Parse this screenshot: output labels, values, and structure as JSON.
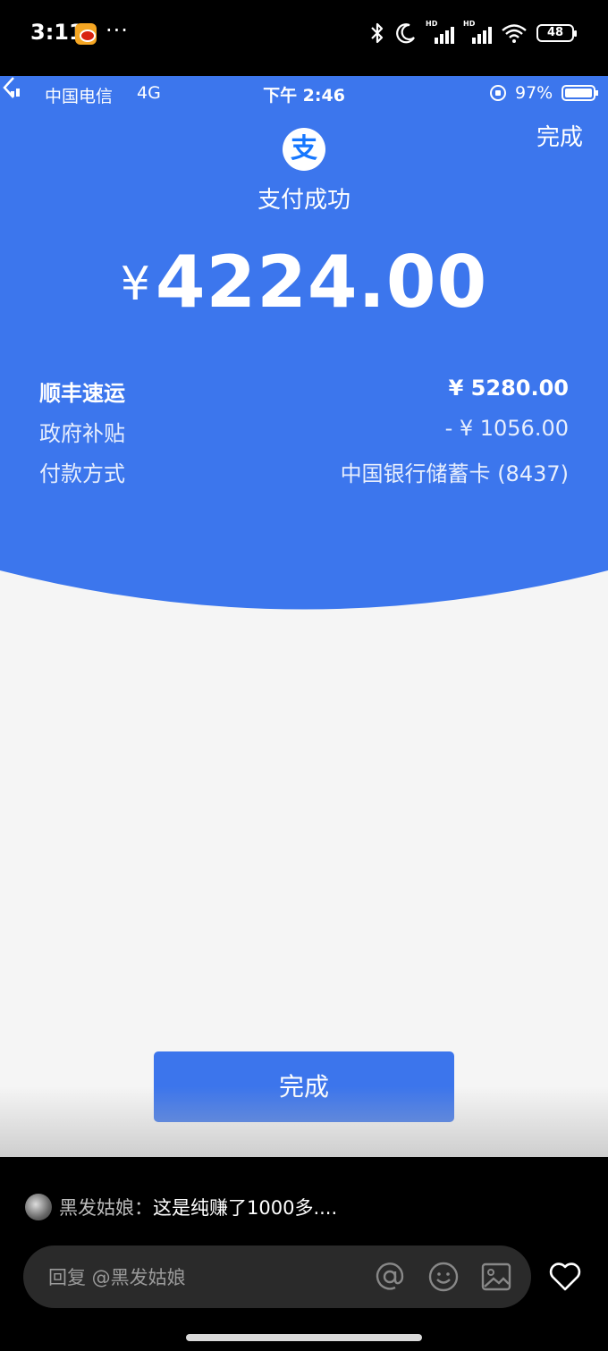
{
  "outer_status": {
    "time": "3:11",
    "dots": "···",
    "battery": "48",
    "icons": [
      "weibo-icon",
      "bluetooth-icon",
      "moon-icon",
      "signal-hd-icon",
      "signal-hd-icon",
      "wifi-icon",
      "battery-icon"
    ]
  },
  "inner_status": {
    "carrier": "中国电信",
    "network": "4G",
    "time": "下午 2:46",
    "battery_pct": "97%"
  },
  "header": {
    "done_label": "完成",
    "logo_char": "支",
    "success_text": "支付成功"
  },
  "payment": {
    "currency": "¥",
    "amount": "4224.00",
    "rows": [
      {
        "label": "顺丰速运",
        "value": "¥ 5280.00"
      },
      {
        "label": "政府补贴",
        "value": "- ¥ 1056.00"
      },
      {
        "label": "付款方式",
        "value": "中国银行储蓄卡 (8437)"
      }
    ]
  },
  "footer": {
    "done_button": "完成"
  },
  "comment": {
    "author": "黑发姑娘：",
    "text": "这是纯赚了1000多...."
  },
  "reply": {
    "placeholder": "回复 @黑发姑娘"
  },
  "colors": {
    "brand_blue": "#3c76ed",
    "button_blue": "#3c75ec",
    "page_bg": "#f5f5f5",
    "dark_bg": "#000000"
  }
}
